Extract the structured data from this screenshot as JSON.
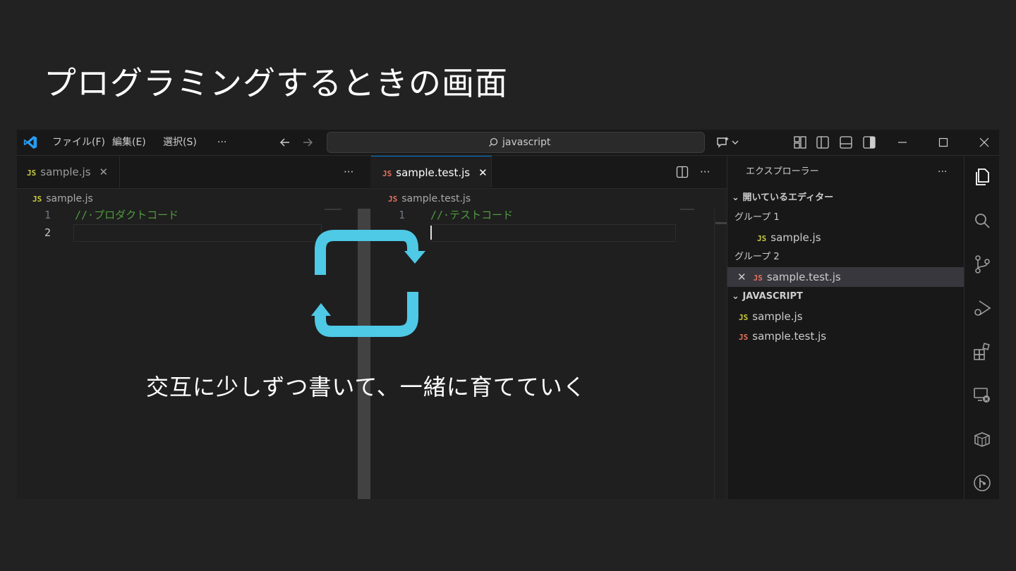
{
  "slide": {
    "title": "プログラミングするときの画面",
    "caption": "交互に少しずつ書いて、一緒に育てていく"
  },
  "titlebar": {
    "menu": [
      "ファイル(F)",
      "編集(E)",
      "選択(S)",
      "···"
    ],
    "search_text": "javascript"
  },
  "editor_left": {
    "tab_label": "sample.js",
    "tab_badge": "JS",
    "more": "···",
    "breadcrumb": "sample.js",
    "lines": [
      {
        "num": "1",
        "text": "//·プロダクトコード"
      },
      {
        "num": "2",
        "text": ""
      }
    ]
  },
  "editor_right": {
    "tab_label": "sample.test.js",
    "tab_badge": "JS",
    "more": "···",
    "breadcrumb": "sample.test.js",
    "lines": [
      {
        "num": "1",
        "text": "//·テストコード"
      }
    ]
  },
  "sidebar": {
    "title": "エクスプローラー",
    "more": "···",
    "open_editors": "開いているエディター",
    "group1": "グループ 1",
    "group1_file": "sample.js",
    "group2": "グループ 2",
    "group2_file": "sample.test.js",
    "folder": "JAVASCRIPT",
    "files": [
      "sample.js",
      "sample.test.js"
    ]
  },
  "colors": {
    "accent": "#0078d4",
    "cycle_arrow": "#4ec9e6",
    "js_yellow": "#cbcb41",
    "js_red": "#e8715c",
    "comment": "#4f9b3f"
  }
}
